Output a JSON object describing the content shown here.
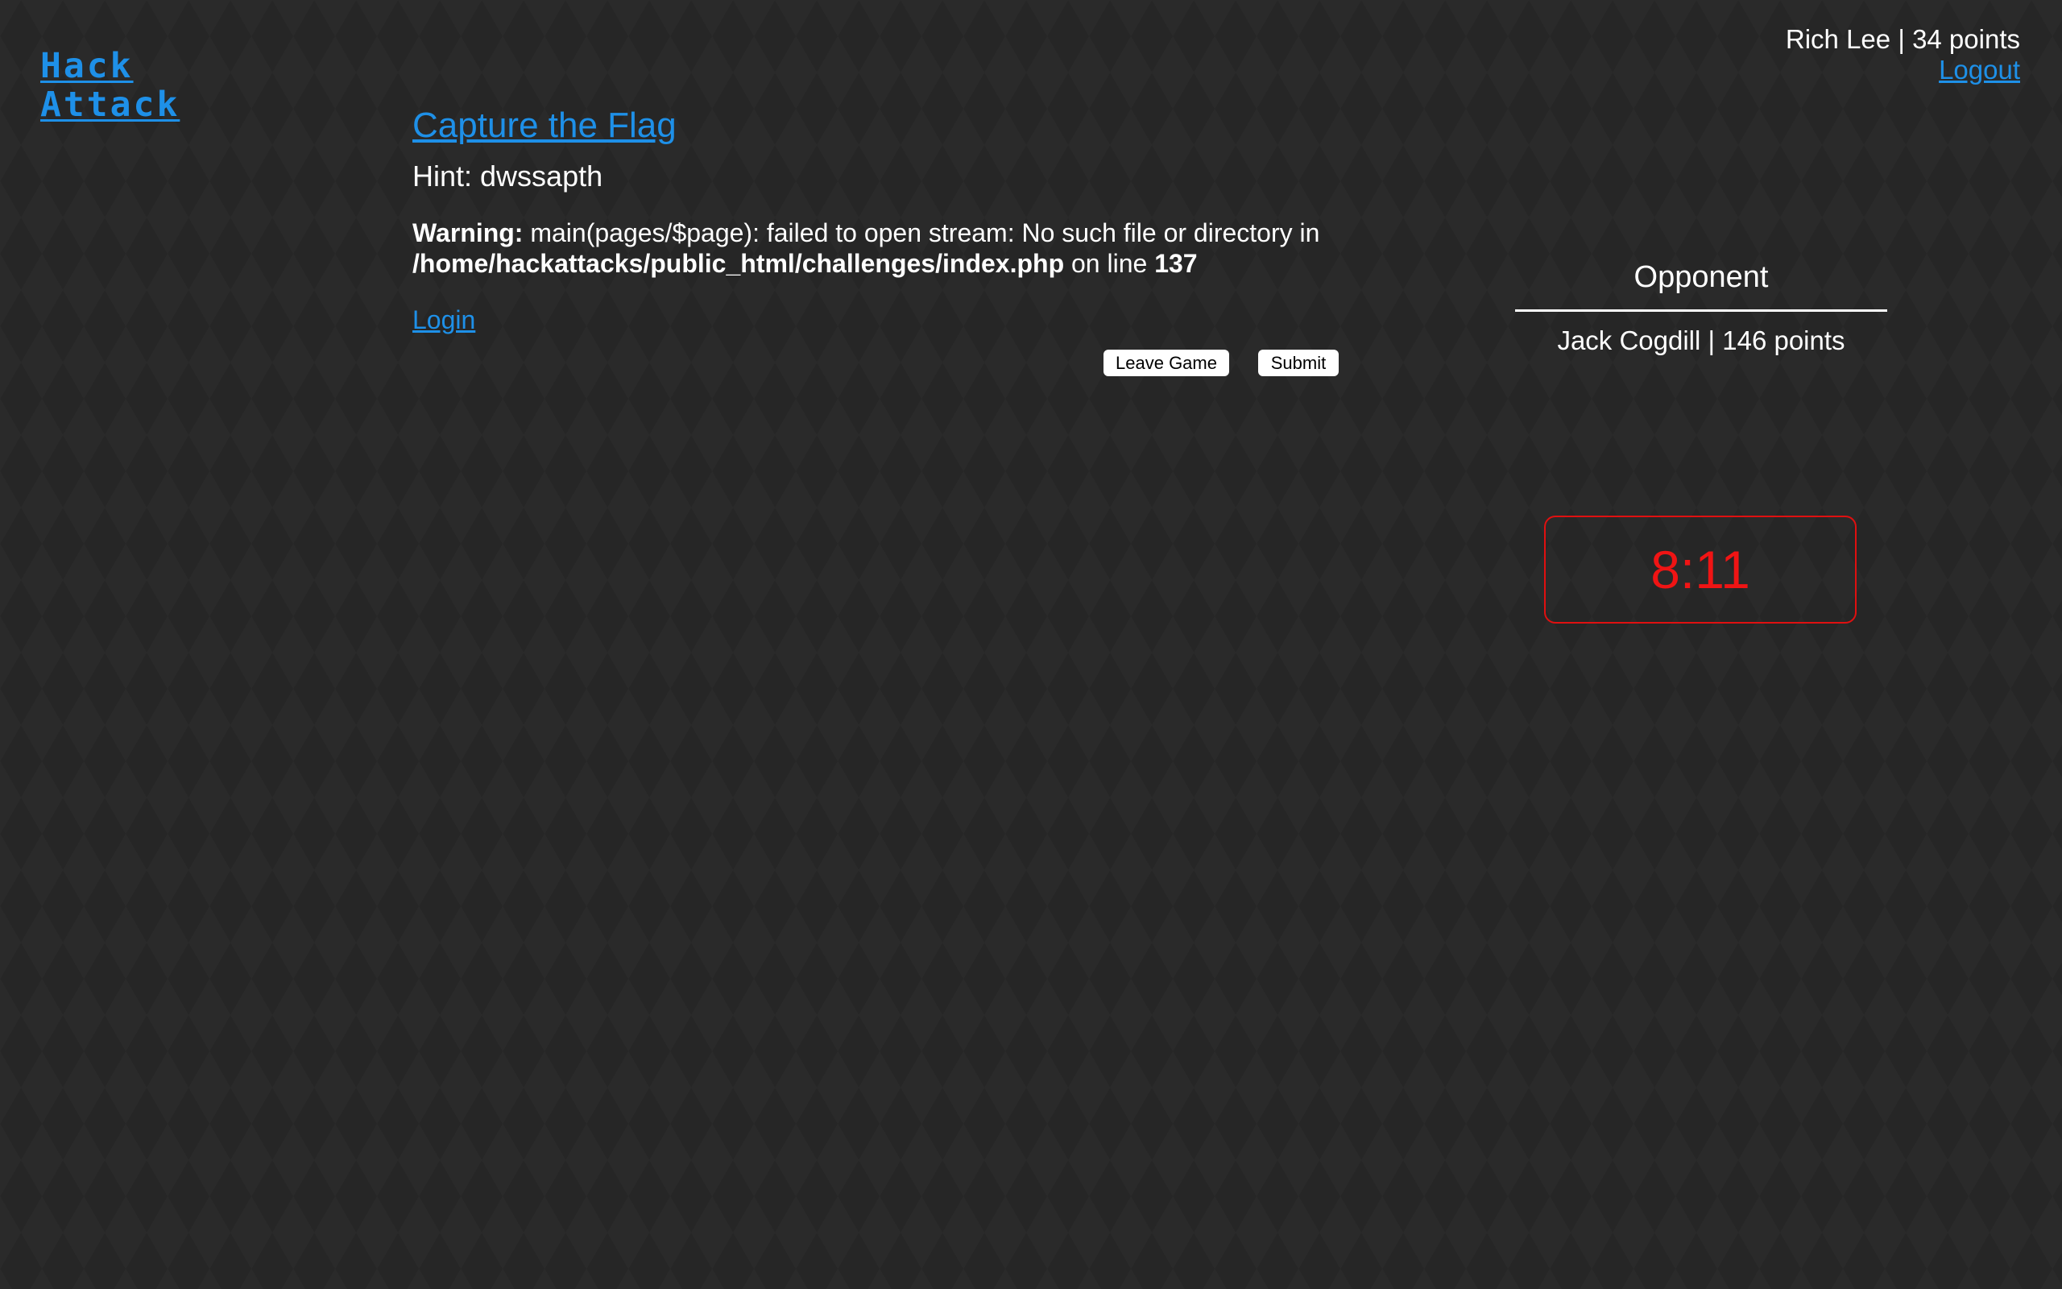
{
  "logo": {
    "line1": "Hack",
    "line2": "Attack"
  },
  "user": {
    "name": "Rich Lee",
    "separator": "|",
    "points": "34 points",
    "logout_label": "Logout"
  },
  "challenge": {
    "title": "Capture the Flag",
    "hint": "Hint: dwssapth",
    "warning": {
      "label": "Warning:",
      "message": " main(pages/$page): failed to open stream: No such file or directory in",
      "path": "/home/hackattacks/public_html/challenges/index.php",
      "on_line": " on line ",
      "line_number": "137"
    },
    "login_label": "Login"
  },
  "buttons": {
    "leave_label": "Leave Game",
    "submit_label": "Submit"
  },
  "opponent": {
    "heading": "Opponent",
    "player": "Jack Cogdill | 146 points"
  },
  "timer": {
    "value": "8:11"
  },
  "colors": {
    "background": "#262626",
    "link": "#1e90e8",
    "timer": "#f01414",
    "text": "#ffffff"
  }
}
